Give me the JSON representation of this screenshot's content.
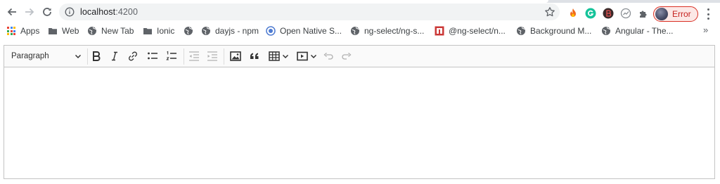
{
  "browser": {
    "url_host": "localhost",
    "url_port": ":4200",
    "profile_label": "Error",
    "overflow": "»"
  },
  "bookmarks": [
    {
      "label": "Apps",
      "icon": "apps-grid-icon"
    },
    {
      "label": "Web",
      "icon": "folder-icon"
    },
    {
      "label": "New Tab",
      "icon": "globe-icon"
    },
    {
      "label": "Ionic",
      "icon": "folder-icon"
    },
    {
      "label": "dayjs - npm",
      "icon": "globe-icon"
    },
    {
      "label": "Open Native S...",
      "icon": "target-icon"
    },
    {
      "label": "ng-select/ng-s...",
      "icon": "globe-icon"
    },
    {
      "label": "@ng-select/n...",
      "icon": "npm-icon"
    },
    {
      "label": "Background M...",
      "icon": "globe-icon"
    },
    {
      "label": "Angular - The...",
      "icon": "globe-icon"
    }
  ],
  "editor": {
    "heading_value": "Paragraph",
    "content_text": ""
  },
  "colors": {
    "profile_border": "#d93025",
    "profile_text": "#c5221f",
    "npm_red": "#cb3837",
    "target_blue": "#4e7bd1"
  }
}
